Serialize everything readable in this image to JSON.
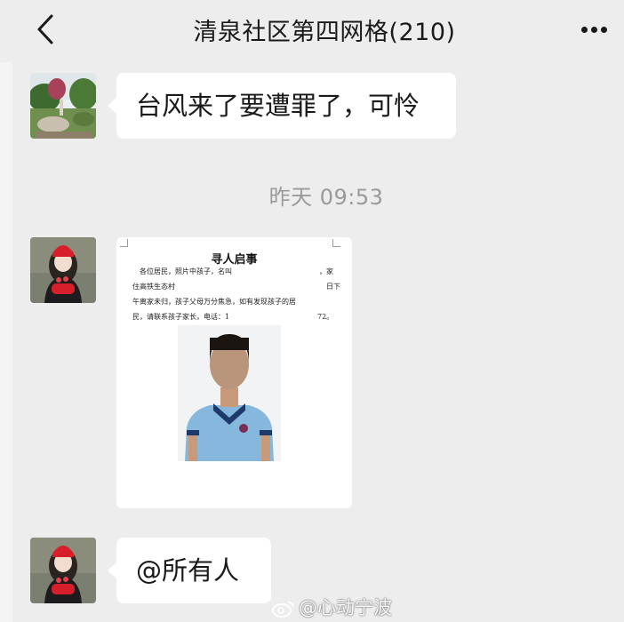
{
  "header": {
    "title": "清泉社区第四网格(210)"
  },
  "messages": [
    {
      "type": "text",
      "text": "台风来了要遭罪了，可怜"
    },
    {
      "type": "timestamp",
      "text": "昨天 09:53"
    },
    {
      "type": "image",
      "notice": {
        "title": "寻人启事",
        "lines": [
          "各位居民，照片中孩子，名叫",
          "住高铁生态村",
          "午离家未归，孩子父母万分焦急，如有发现孩子的居",
          "民，请联系孩子家长，电话：1"
        ],
        "line_fragments": [
          "，家",
          "日下",
          "72。"
        ]
      }
    },
    {
      "type": "text",
      "text": "@所有人"
    }
  ],
  "watermark": {
    "text": "@心动宁波"
  },
  "colors": {
    "background": "#ededed",
    "bubble": "#ffffff",
    "timestamp": "#9a9a9a"
  }
}
